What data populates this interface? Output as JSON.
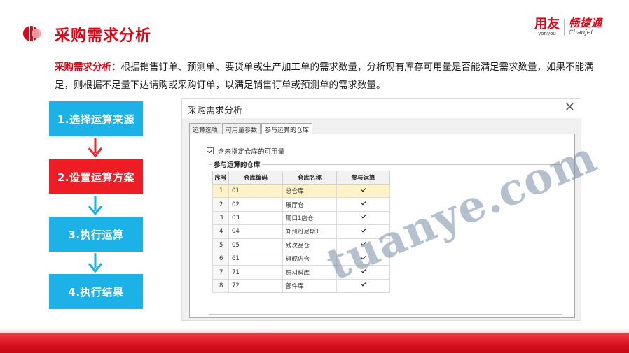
{
  "slide": {
    "title": "采购需求分析",
    "brand_cn": "用友",
    "brand_en": "yonyou",
    "product_cn": "畅捷通",
    "product_en": "Chanjet",
    "accent_color": "#e60012"
  },
  "description": {
    "lead": "采购需求分析：",
    "body": "根据销售订单、预测单、要货单或生产加工单的需求数量，分析现有库存可用量是否能满足需求数量，如果不能满足，则根据不足量下达请购或采购订单，以满足销售订单或预测单的需求数量。"
  },
  "steps": [
    {
      "label": "1.选择运算来源",
      "color": "#1cb2e8"
    },
    {
      "label": "2.设置运算方案",
      "color": "#ee1c25"
    },
    {
      "label": "3.执行运算",
      "color": "#1cb2e8"
    },
    {
      "label": "4.执行结果",
      "color": "#1cb2e8"
    }
  ],
  "dialog": {
    "title": "采购需求分析",
    "close_icon": "close-icon",
    "tabs": [
      "运算选项",
      "可用量参数",
      "参与运算的仓库"
    ],
    "active_tab": "参与运算的仓库",
    "checkbox_label": "含未指定仓库的可用量",
    "checkbox_checked": true,
    "group_title": "参与运算的仓库",
    "columns": [
      "序号",
      "仓库编码",
      "仓库名称",
      "参与运算"
    ],
    "rows": [
      {
        "no": "1",
        "code": "01",
        "name": "总仓库",
        "checked": true
      },
      {
        "no": "2",
        "code": "02",
        "name": "展厅仓",
        "checked": true
      },
      {
        "no": "3",
        "code": "03",
        "name": "周口1店仓",
        "checked": true
      },
      {
        "no": "4",
        "code": "04",
        "name": "郑州丹尼斯1...",
        "checked": true
      },
      {
        "no": "5",
        "code": "05",
        "name": "残次品仓",
        "checked": true
      },
      {
        "no": "6",
        "code": "61",
        "name": "旗舰店仓",
        "checked": true
      },
      {
        "no": "7",
        "code": "71",
        "name": "原材料库",
        "checked": true
      },
      {
        "no": "8",
        "code": "72",
        "name": "部件库",
        "checked": true
      }
    ]
  },
  "watermark": "tuanye.com"
}
